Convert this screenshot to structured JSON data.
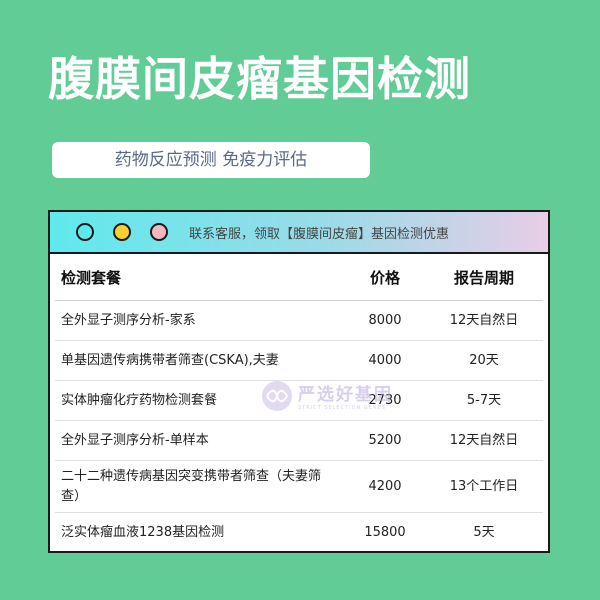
{
  "title": "腹膜间皮瘤基因检测",
  "subtitle": "药物反应预测 免疫力评估",
  "window": {
    "titlebar_text": "联系客服，领取【腹膜间皮瘤】基因检测优惠",
    "dot_colors": [
      "#5fe9ec",
      "#f5d131",
      "#f5b6c2"
    ]
  },
  "table": {
    "headers": [
      "检测套餐",
      "价格",
      "报告周期"
    ],
    "rows": [
      [
        "全外显子测序分析-家系",
        "8000",
        "12天自然日"
      ],
      [
        "单基因遗传病携带者筛查(CSKA),夫妻",
        "4000",
        "20天"
      ],
      [
        "实体肿瘤化疗药物检测套餐",
        "2730",
        "5-7天"
      ],
      [
        "全外显子测序分析-单样本",
        "5200",
        "12天自然日"
      ],
      [
        "二十二种遗传病基因突变携带者筛查（夫妻筛查）",
        "4200",
        "13个工作日"
      ],
      [
        "泛实体瘤血液1238基因检测",
        "15800",
        "5天"
      ]
    ]
  },
  "watermark": {
    "text": "严选好基因",
    "subtext": "STRICT SELECTION GENES"
  },
  "colors": {
    "background": "#62cc96",
    "accent_text": "#5a6a8a"
  }
}
